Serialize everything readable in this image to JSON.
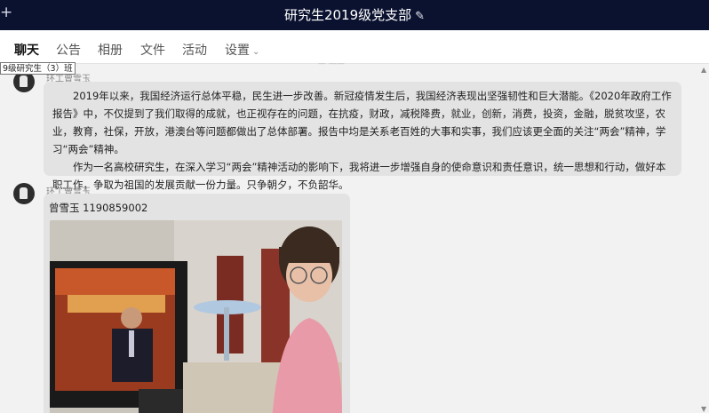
{
  "window": {
    "title": "研究生2019级党支部"
  },
  "tabs": [
    {
      "label": "聊天",
      "active": true
    },
    {
      "label": "公告",
      "active": false
    },
    {
      "label": "相册",
      "active": false
    },
    {
      "label": "文件",
      "active": false
    },
    {
      "label": "活动",
      "active": false
    },
    {
      "label": "设置",
      "active": false
    }
  ],
  "tooltip": {
    "text": "9级研究生（3）班"
  },
  "messages": [
    {
      "sender": "环工曾雪玉",
      "paragraphs": [
        "2019年以来，我国经济运行总体平稳，民生进一步改善。新冠疫情发生后，我国经济表现出坚强韧性和巨大潜能。《2020年政府工作报告》中，不仅提到了我们取得的成就，也正视存在的问题，在抗疫，财政，减税降费，就业，创新，消费，投资，金融，脱贫攻坚，农业，教育，社保，开放，港澳台等问题都做出了总体部署。报告中均是关系老百姓的大事和实事，我们应该更全面的关注“两会”精神，学习“两会”精神。",
        "作为一名高校研究生，在深入学习“两会”精神活动的影响下，我将进一步增强自身的使命意识和责任意识，统一思想和行动，做好本职工作，争取为祖国的发展贡献一份力量。只争朝夕，不负韶华。"
      ]
    },
    {
      "sender": "环工曾雪玉",
      "text": "曾雪玉 1190859002"
    }
  ],
  "icons": {
    "plus": "plus-icon",
    "edit": "edit-icon",
    "settings_chevron": "chevron-down-icon"
  },
  "colors": {
    "titlebar": "#0b1230",
    "bubble": "#e3e3e3",
    "background": "#f2f2f2"
  }
}
